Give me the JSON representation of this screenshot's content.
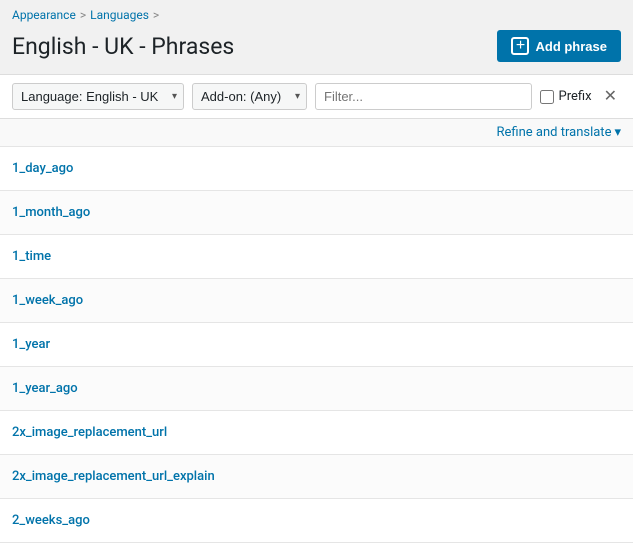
{
  "breadcrumb": {
    "items": [
      {
        "label": "Appearance",
        "link": true
      },
      {
        "label": "Languages",
        "link": true
      }
    ],
    "separators": [
      ">",
      ">"
    ]
  },
  "header": {
    "title": "English - UK - Phrases",
    "add_button_label": "Add phrase"
  },
  "filters": {
    "language_label": "Language: English - UK",
    "language_placeholder": "Language: English - UK",
    "addon_label": "Add-on: (Any)",
    "addon_placeholder": "Add-on: (Any)",
    "filter_placeholder": "Filter...",
    "prefix_label": "Prefix"
  },
  "refine": {
    "label": "Refine and translate",
    "arrow": "▾"
  },
  "phrases": [
    {
      "key": "1_day_ago"
    },
    {
      "key": "1_month_ago"
    },
    {
      "key": "1_time"
    },
    {
      "key": "1_week_ago"
    },
    {
      "key": "1_year"
    },
    {
      "key": "1_year_ago"
    },
    {
      "key": "2x_image_replacement_url"
    },
    {
      "key": "2x_image_replacement_url_explain"
    },
    {
      "key": "2_weeks_ago"
    }
  ],
  "colors": {
    "accent": "#0073aa",
    "border": "#ddd",
    "bg_light": "#f9f9f9"
  }
}
